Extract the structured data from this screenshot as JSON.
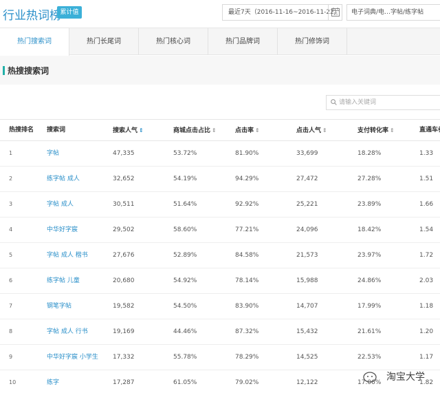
{
  "header": {
    "title": "行业热词榜",
    "badge": "累计值",
    "date_range": "最近7天（2016-11-16~2016-11-22）",
    "category": "电子词典/电…字帖/练字帖"
  },
  "tabs": [
    {
      "label": "热门搜索词",
      "active": true
    },
    {
      "label": "热门长尾词",
      "active": false
    },
    {
      "label": "热门核心词",
      "active": false
    },
    {
      "label": "热门品牌词",
      "active": false
    },
    {
      "label": "热门修饰词",
      "active": false
    }
  ],
  "section": {
    "title": "热搜搜索词"
  },
  "search": {
    "placeholder": "请输入关键词"
  },
  "table": {
    "headers": [
      "热搜排名",
      "搜索词",
      "搜索人气",
      "商城点击占比",
      "点击率",
      "点击人气",
      "支付转化率",
      "直通车参"
    ],
    "rows": [
      [
        "1",
        "字帖",
        "47,335",
        "53.72%",
        "81.90%",
        "33,699",
        "18.28%",
        "1.33"
      ],
      [
        "2",
        "练字帖 成人",
        "32,652",
        "54.19%",
        "94.29%",
        "27,472",
        "27.28%",
        "1.51"
      ],
      [
        "3",
        "字帖 成人",
        "30,511",
        "51.64%",
        "92.92%",
        "25,221",
        "23.89%",
        "1.66"
      ],
      [
        "4",
        "中华好字宸",
        "29,502",
        "58.60%",
        "77.21%",
        "24,096",
        "18.42%",
        "1.54"
      ],
      [
        "5",
        "字帖 成人 楷书",
        "27,676",
        "52.89%",
        "84.58%",
        "21,573",
        "23.97%",
        "1.72"
      ],
      [
        "6",
        "练字帖 儿童",
        "20,680",
        "54.92%",
        "78.14%",
        "15,988",
        "24.86%",
        "2.03"
      ],
      [
        "7",
        "钢笔字帖",
        "19,582",
        "54.50%",
        "83.90%",
        "14,707",
        "17.99%",
        "1.18"
      ],
      [
        "8",
        "字帖 成人 行书",
        "19,169",
        "44.46%",
        "87.32%",
        "15,432",
        "21.61%",
        "1.20"
      ],
      [
        "9",
        "中华好字宸 小学生",
        "17,332",
        "55.78%",
        "78.29%",
        "14,525",
        "22.53%",
        "1.17"
      ],
      [
        "10",
        "练字",
        "17,287",
        "61.05%",
        "79.02%",
        "12,122",
        "17.06%",
        "1.82"
      ]
    ]
  },
  "watermark": {
    "text": "淘宝大学"
  },
  "colors": {
    "accent": "#2a8fc9",
    "badge": "#3bb0d8",
    "section_bar": "#21b0a8"
  }
}
